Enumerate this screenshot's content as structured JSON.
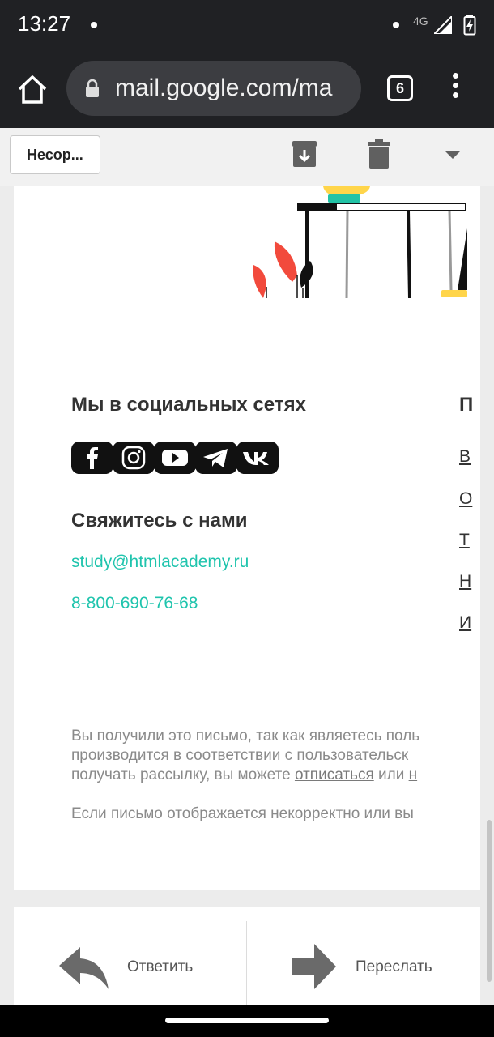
{
  "status_bar": {
    "time": "13:27",
    "network": "4G"
  },
  "browser": {
    "url": "mail.google.com/ma",
    "tab_count": "6"
  },
  "toolbar": {
    "back_label": "Несор..."
  },
  "email": {
    "social_heading": "Мы в социальных сетях",
    "social_icons": [
      "facebook-icon",
      "instagram-icon",
      "youtube-icon",
      "telegram-icon",
      "vk-icon"
    ],
    "contact_heading": "Свяжитесь с нами",
    "email": "study@htmlacademy.ru",
    "phone": "8-800-690-76-68",
    "col2_heading": "П",
    "col2_links": [
      "В",
      "О",
      "Т",
      "Н",
      "И"
    ],
    "footer": {
      "line1": "Вы получили это письмо, так как являетесь поль",
      "line2": "производится в соответствии с пользовательск",
      "line3_start": "получать рассылку, вы можете ",
      "unsubscribe": "отписаться",
      "line3_mid": " или ",
      "line3_end": "н",
      "line4": "Если письмо отображается некорректно или вы"
    }
  },
  "actions": {
    "reply": "Ответить",
    "forward": "Переслать"
  },
  "colors": {
    "accent": "#1fc4ad",
    "leaf": "#f24a3c",
    "lamp": "#ffd54a",
    "dark_bar": "#202124"
  }
}
